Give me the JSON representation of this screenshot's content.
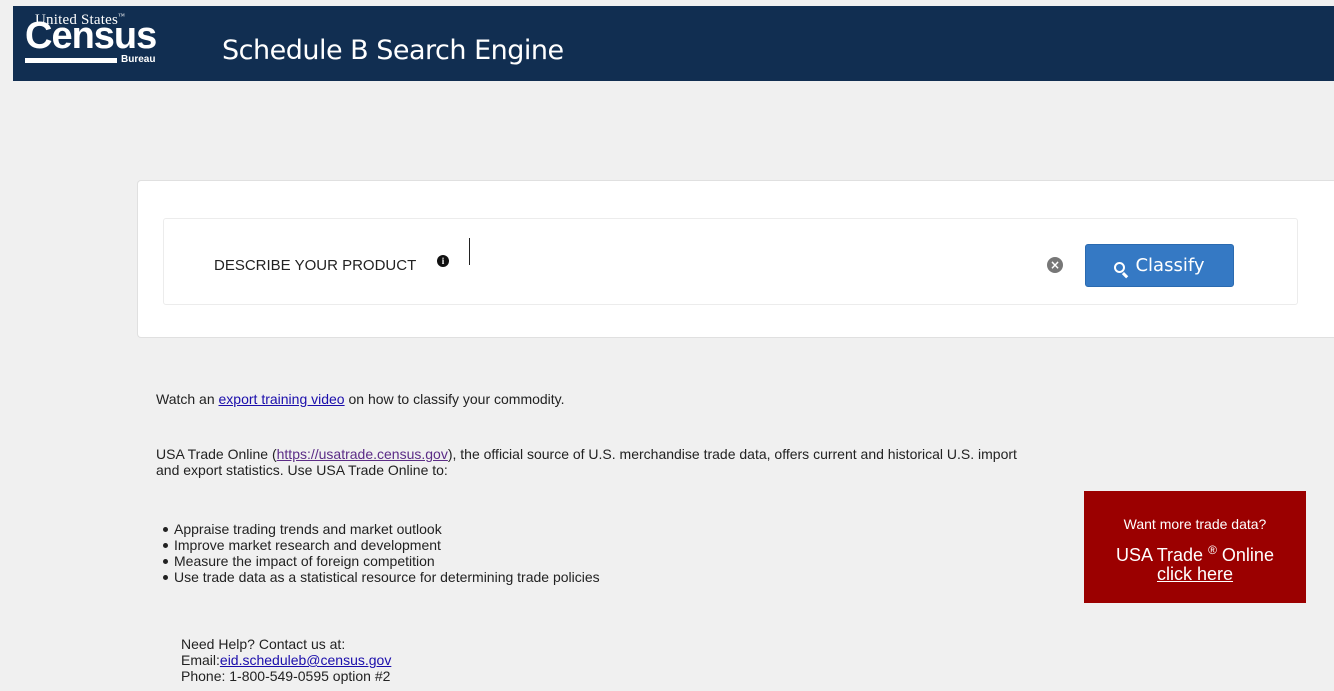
{
  "header": {
    "logo": {
      "line1": "United States",
      "tm": "™",
      "line2": "Census",
      "line3": "Bureau"
    },
    "title": "Schedule B Search Engine",
    "background_color": "#112e51"
  },
  "search": {
    "label": "DESCRIBE YOUR PRODUCT",
    "info_icon": "info-circle-icon",
    "input_value": "",
    "clear_icon": "times-circle-icon",
    "classify_label": "Classify",
    "classify_icon": "search-icon",
    "button_color": "#3579c4"
  },
  "content": {
    "training": {
      "prefix": "Watch an ",
      "link_text": "export training video",
      "suffix": " on how to classify your commodity."
    },
    "usatrade": {
      "prefix": "USA Trade Online (",
      "link_text": "https://usatrade.census.gov",
      "suffix": "), the official source of U.S. merchandise trade data, offers current and historical U.S. import and export statistics. Use USA Trade Online to:"
    },
    "bullets": [
      "Appraise trading trends and market outlook",
      "Improve market research and development",
      "Measure the impact of foreign competition",
      "Use trade data as a statistical resource for determining trade policies"
    ]
  },
  "help": {
    "heading": "Need Help? Contact us at:",
    "email_label": "Email:",
    "email": "eid.scheduleb@census.gov",
    "phone": "Phone: 1-800-549-0595 option #2"
  },
  "promo": {
    "line1": "Want more trade data?",
    "line2_prefix": "USA Trade ",
    "line2_reg": "®",
    "line2_suffix": " Online",
    "link_text": "click here",
    "background_color": "#9b0000"
  }
}
